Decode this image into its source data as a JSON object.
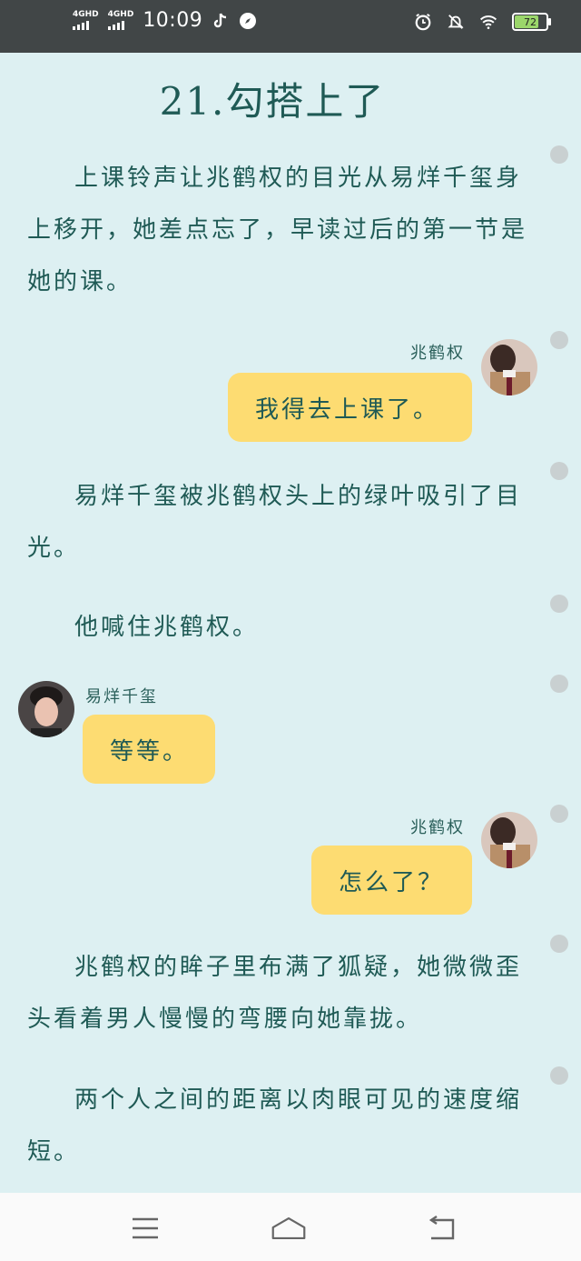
{
  "status_bar": {
    "network_1": "4GHD",
    "network_2": "4GHD",
    "time": "10:09",
    "battery": "72",
    "icons": [
      "tiktok-icon",
      "compass-icon",
      "alarm-icon",
      "mute-bell-icon",
      "wifi-icon",
      "battery-icon"
    ]
  },
  "chapter": {
    "title": "21.勾搭上了"
  },
  "paragraphs": [
    "上课铃声让兆鹤权的目光从易烊千玺身上移开，她差点忘了，早读过后的第一节是她的课。",
    "易烊千玺被兆鹤权头上的绿叶吸引了目光。",
    "他喊住兆鹤权。",
    "兆鹤权的眸子里布满了狐疑，她微微歪头看着男人慢慢的弯腰向她靠拢。",
    "两个人之间的距离以肉眼可见的速度缩短。"
  ],
  "messages": [
    {
      "speaker": "兆鹤权",
      "text": "我得去上课了。",
      "side": "right"
    },
    {
      "speaker": "易烊千玺",
      "text": "等等。",
      "side": "left"
    },
    {
      "speaker": "兆鹤权",
      "text": "怎么了？",
      "side": "right"
    }
  ],
  "nav": {
    "icons": [
      "menu-icon",
      "home-icon",
      "back-icon"
    ]
  },
  "colors": {
    "background": "#ddf0f2",
    "status_bar": "#414647",
    "text": "#1f5a55",
    "bubble": "#fddc72",
    "comment_dot": "#c9d0d1"
  }
}
